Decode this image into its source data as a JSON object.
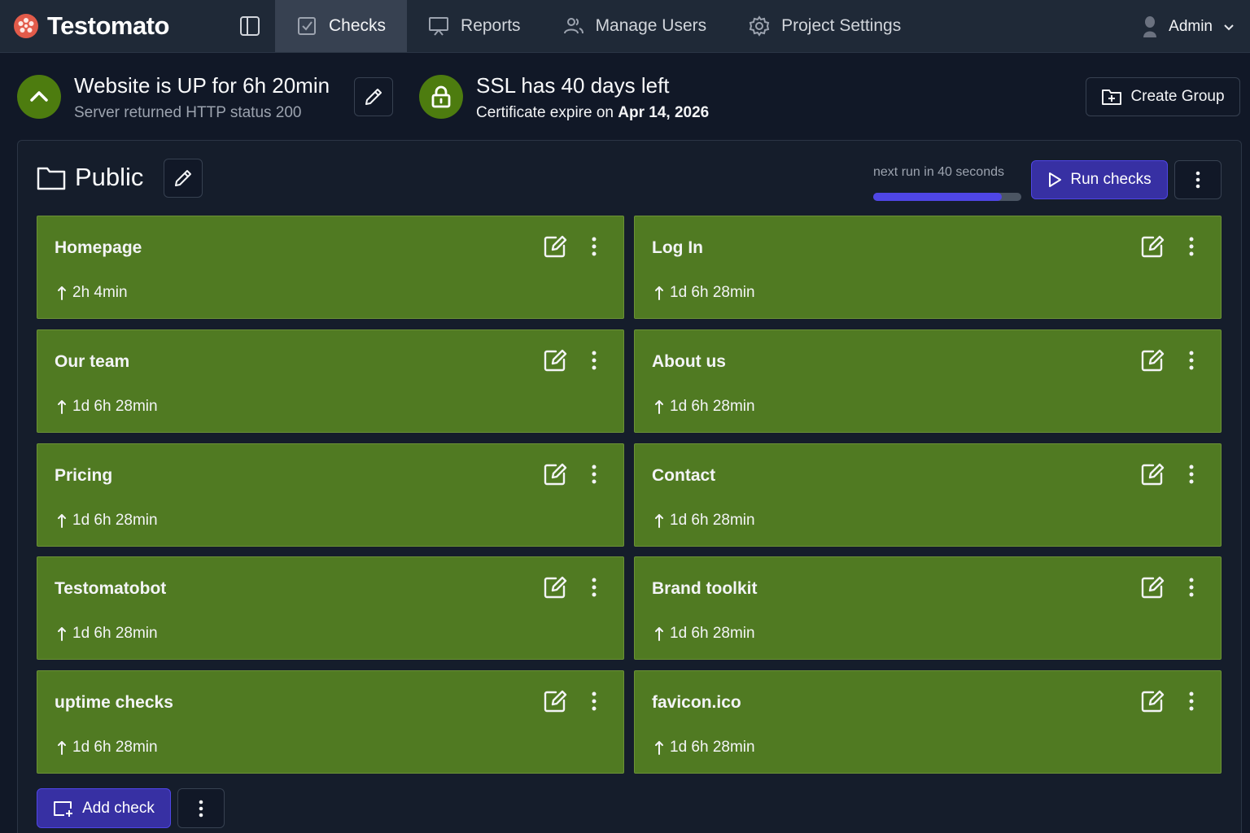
{
  "app": {
    "name": "Testomato",
    "accent_color": "#4f46e5",
    "status_up_color": "#4d7c0f",
    "card_color": "#507a22"
  },
  "nav": {
    "items": [
      {
        "label": "Checks",
        "icon": "checkbox-icon",
        "active": true
      },
      {
        "label": "Reports",
        "icon": "presentation-icon",
        "active": false
      },
      {
        "label": "Manage Users",
        "icon": "users-icon",
        "active": false
      },
      {
        "label": "Project Settings",
        "icon": "gear-icon",
        "active": false
      }
    ],
    "user": {
      "name": "Admin"
    }
  },
  "status": {
    "uptime": {
      "title": "Website is UP for 6h 20min",
      "subtitle": "Server returned HTTP status 200"
    },
    "ssl": {
      "title": "SSL has 40 days left",
      "subtitle_prefix": "Certificate expire on",
      "expire_date": "Apr 14, 2026"
    }
  },
  "toolbar": {
    "create_group_label": "Create Group"
  },
  "group": {
    "name": "Public",
    "next_run_text": "next run in 40 seconds",
    "next_run_progress": 0.87,
    "run_checks_label": "Run checks",
    "add_check_label": "Add check",
    "checks": [
      {
        "name": "Homepage",
        "uptime": "2h 4min"
      },
      {
        "name": "Log In",
        "uptime": "1d 6h 28min"
      },
      {
        "name": "Our team",
        "uptime": "1d 6h 28min"
      },
      {
        "name": "About us",
        "uptime": "1d 6h 28min"
      },
      {
        "name": "Pricing",
        "uptime": "1d 6h 28min"
      },
      {
        "name": "Contact",
        "uptime": "1d 6h 28min"
      },
      {
        "name": "Testomatobot",
        "uptime": "1d 6h 28min"
      },
      {
        "name": "Brand toolkit",
        "uptime": "1d 6h 28min"
      },
      {
        "name": "uptime checks",
        "uptime": "1d 6h 28min"
      },
      {
        "name": "favicon.ico",
        "uptime": "1d 6h 28min"
      }
    ]
  }
}
